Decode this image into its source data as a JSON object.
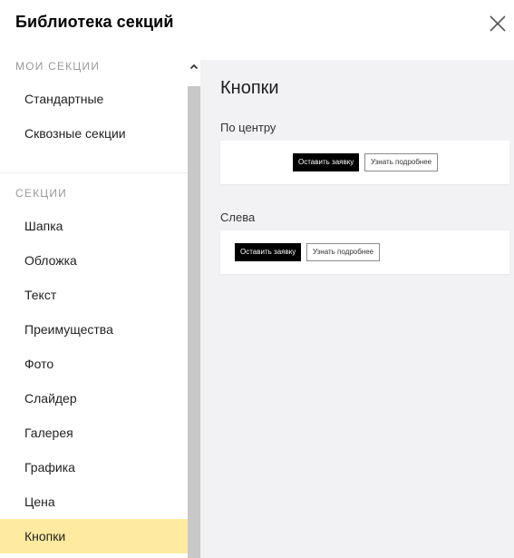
{
  "header": {
    "title": "Библиотека секций"
  },
  "sidebar": {
    "my_sections_title": "Мои секции",
    "my_sections": [
      {
        "label": "Стандартные"
      },
      {
        "label": "Сквозные секции"
      }
    ],
    "sections_title": "Секции",
    "sections": [
      {
        "label": "Шапка"
      },
      {
        "label": "Обложка"
      },
      {
        "label": "Текст"
      },
      {
        "label": "Преимущества"
      },
      {
        "label": "Фото"
      },
      {
        "label": "Слайдер"
      },
      {
        "label": "Галерея"
      },
      {
        "label": "Графика"
      },
      {
        "label": "Цена"
      },
      {
        "label": "Кнопки",
        "active": true
      }
    ]
  },
  "main": {
    "title": "Кнопки",
    "variants": [
      {
        "label": "По центру",
        "primary_button": "Оставить заявку",
        "secondary_button": "Узнать подробнее"
      },
      {
        "label": "Слева",
        "primary_button": "Оставить заявку",
        "secondary_button": "Узнать подробнее"
      }
    ]
  },
  "colors": {
    "active_item": "#ffeba0",
    "main_background": "#f2f2f4",
    "primary_button": "#000000",
    "scrollbar_thumb": "#c8c8c8"
  }
}
